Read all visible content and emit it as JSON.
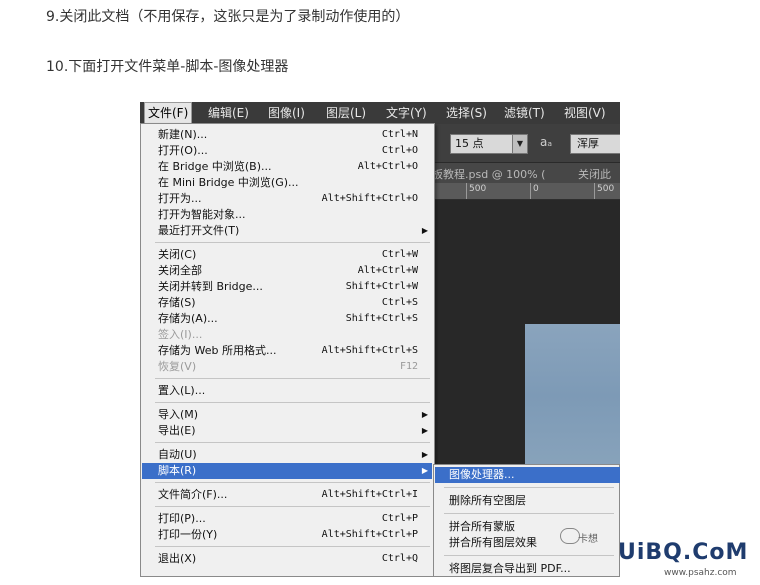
{
  "steps": {
    "step9": "9.关闭此文档（不用保存，这张只是为了录制动作使用的）",
    "step10": "10.下面打开文件菜单-脚本-图像处理器"
  },
  "menubar": [
    "文件(F)",
    "编辑(E)",
    "图像(I)",
    "图层(L)",
    "文字(Y)",
    "选择(S)",
    "滤镜(T)",
    "视图(V)"
  ],
  "options": {
    "font_size": "15 点",
    "aa_icon": "aₐ",
    "aa_mode": "浑厚"
  },
  "doc": {
    "tab_title": "板教程.psd @ 100% (",
    "tab_close": "关闭此",
    "ruler_ticks": [
      "500",
      "0",
      "500"
    ]
  },
  "file_menu": [
    {
      "label": "新建(N)...",
      "shortcut": "Ctrl+N"
    },
    {
      "label": "打开(O)...",
      "shortcut": "Ctrl+O"
    },
    {
      "label": "在 Bridge 中浏览(B)...",
      "shortcut": "Alt+Ctrl+O"
    },
    {
      "label": "在 Mini Bridge 中浏览(G)...",
      "shortcut": ""
    },
    {
      "label": "打开为...",
      "shortcut": "Alt+Shift+Ctrl+O"
    },
    {
      "label": "打开为智能对象...",
      "shortcut": ""
    },
    {
      "label": "最近打开文件(T)",
      "shortcut": "",
      "submenu": true
    },
    {
      "separator": true
    },
    {
      "label": "关闭(C)",
      "shortcut": "Ctrl+W"
    },
    {
      "label": "关闭全部",
      "shortcut": "Alt+Ctrl+W"
    },
    {
      "label": "关闭并转到 Bridge...",
      "shortcut": "Shift+Ctrl+W"
    },
    {
      "label": "存储(S)",
      "shortcut": "Ctrl+S"
    },
    {
      "label": "存储为(A)...",
      "shortcut": "Shift+Ctrl+S"
    },
    {
      "label": "签入(I)...",
      "shortcut": "",
      "disabled": true
    },
    {
      "label": "存储为 Web 所用格式...",
      "shortcut": "Alt+Shift+Ctrl+S"
    },
    {
      "label": "恢复(V)",
      "shortcut": "F12",
      "disabled": true
    },
    {
      "separator": true
    },
    {
      "label": "置入(L)...",
      "shortcut": ""
    },
    {
      "separator": true
    },
    {
      "label": "导入(M)",
      "shortcut": "",
      "submenu": true
    },
    {
      "label": "导出(E)",
      "shortcut": "",
      "submenu": true
    },
    {
      "separator": true
    },
    {
      "label": "自动(U)",
      "shortcut": "",
      "submenu": true
    },
    {
      "label": "脚本(R)",
      "shortcut": "",
      "submenu": true,
      "highlighted": true
    },
    {
      "separator": true
    },
    {
      "label": "文件简介(F)...",
      "shortcut": "Alt+Shift+Ctrl+I"
    },
    {
      "separator": true
    },
    {
      "label": "打印(P)...",
      "shortcut": "Ctrl+P"
    },
    {
      "label": "打印一份(Y)",
      "shortcut": "Alt+Shift+Ctrl+P"
    },
    {
      "separator": true
    },
    {
      "label": "退出(X)",
      "shortcut": "Ctrl+Q"
    }
  ],
  "script_submenu": [
    {
      "label": "图像处理器...",
      "highlighted": true
    },
    {
      "separator": true
    },
    {
      "label": "删除所有空图层"
    },
    {
      "separator": true
    },
    {
      "label": "拼合所有蒙版"
    },
    {
      "label": "拼合所有图层效果"
    },
    {
      "separator": true
    },
    {
      "label": "将图层复合导出到 PDF..."
    }
  ],
  "watermark": {
    "logo": "UiBQ.CoM",
    "url": "www.psahz.com",
    "author": "卡想"
  },
  "colors": {
    "highlight": "#3b6fc9",
    "menubar_bg": "#3a3a3a",
    "canvas_bg": "#282828",
    "image_blue": "#7d9ab6"
  }
}
